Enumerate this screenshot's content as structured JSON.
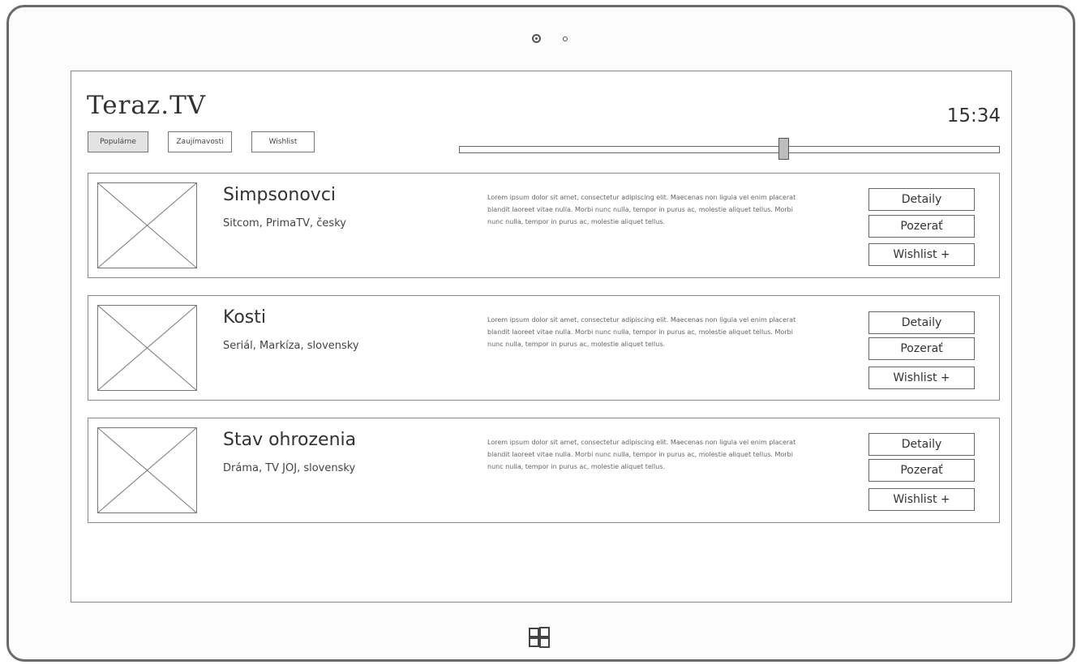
{
  "app": {
    "title": "Teraz.TV",
    "clock": "15:34"
  },
  "tabs": [
    {
      "label": "Populárne",
      "active": true
    },
    {
      "label": "Zaujímavosti",
      "active": false
    },
    {
      "label": "Wishlist",
      "active": false
    }
  ],
  "timeline": {
    "position_fraction": 0.6
  },
  "shows": [
    {
      "title": "Simpsonovci",
      "meta": "Sitcom, PrimaTV, česky",
      "description": "Lorem ipsum dolor sit amet, consectetur adipiscing elit. Maecenas non ligula vel enim placerat blandit laoreet vitae nulla. Morbi nunc nulla, tempor in purus ac, molestie aliquet tellus. Morbi nunc nulla, tempor in purus ac, molestie aliquet tellus.",
      "actions": {
        "details": "Detaily",
        "watch": "Pozerať",
        "wishlist": "Wishlist +"
      }
    },
    {
      "title": "Kosti",
      "meta": "Seriál, Markíza, slovensky",
      "description": "Lorem ipsum dolor sit amet, consectetur adipiscing elit. Maecenas non ligula vel enim placerat blandit laoreet vitae nulla. Morbi nunc nulla, tempor in purus ac, molestie aliquet tellus. Morbi nunc nulla, tempor in purus ac, molestie aliquet tellus.",
      "actions": {
        "details": "Detaily",
        "watch": "Pozerať",
        "wishlist": "Wishlist +"
      }
    },
    {
      "title": "Stav ohrozenia",
      "meta": "Dráma, TV JOJ, slovensky",
      "description": "Lorem ipsum dolor sit amet, consectetur adipiscing elit. Maecenas non ligula vel enim placerat blandit laoreet vitae nulla. Morbi nunc nulla, tempor in purus ac, molestie aliquet tellus. Morbi nunc nulla, tempor in purus ac, molestie aliquet tellus.",
      "actions": {
        "details": "Detaily",
        "watch": "Pozerať",
        "wishlist": "Wishlist +"
      }
    }
  ]
}
